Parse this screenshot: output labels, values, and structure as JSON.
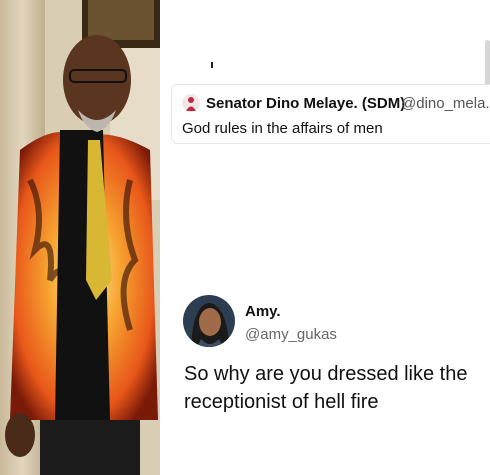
{
  "quoted_tweet": {
    "author_name": "Senator Dino Melaye. (SDM)",
    "author_handle": "@dino_mela.",
    "text": "God rules in the affairs of men"
  },
  "reply": {
    "author_name": "Amy.",
    "author_handle": "@amy_gukas",
    "text": "So why are you dressed like the receptionist of hell fire"
  },
  "colors": {
    "jacket_flame": "#e8571a",
    "tie_gold": "#d8b735"
  }
}
